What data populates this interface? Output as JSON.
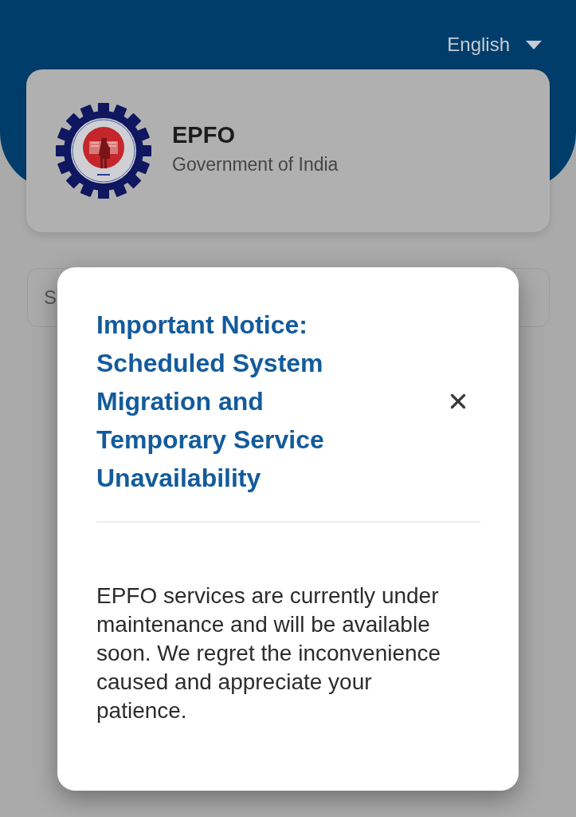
{
  "header": {
    "language": {
      "label": "English"
    }
  },
  "org_card": {
    "name": "EPFO",
    "subtitle": "Government of India"
  },
  "search": {
    "placeholder": "S"
  },
  "dialog": {
    "title": "Important Notice: Scheduled System Migration and Temporary Service Unavailability",
    "body": "EPFO services are currently under maintenance and will be available soon. We regret the inconvenience caused and appreciate your patience."
  }
}
